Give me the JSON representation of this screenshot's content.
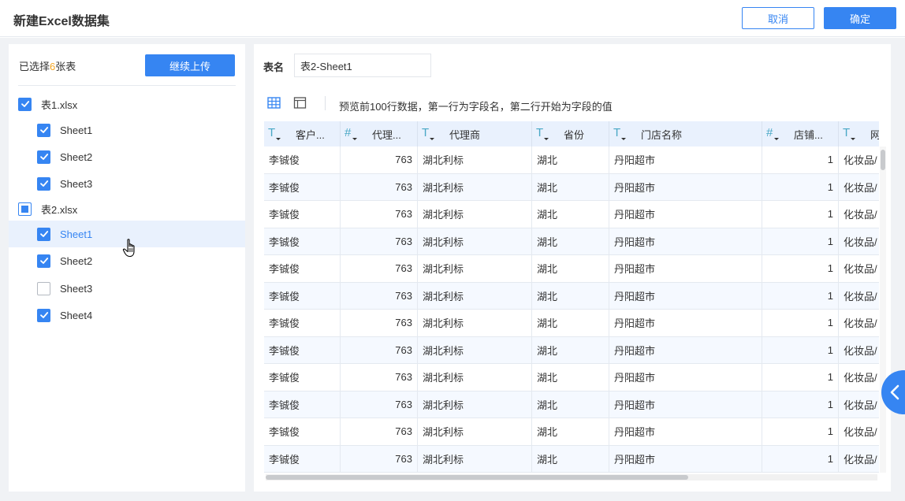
{
  "app": {
    "title": "新建Excel数据集"
  },
  "actions": {
    "cancel_label": "取消",
    "confirm_label": "确定"
  },
  "sidebar": {
    "selected_prefix": "已选择",
    "selected_count": "6",
    "selected_suffix": "张表",
    "continue_upload_label": "继续上传",
    "items": [
      {
        "label": "表1.xlsx",
        "state": "checked",
        "level": 0
      },
      {
        "label": "Sheet1",
        "state": "checked",
        "level": 1
      },
      {
        "label": "Sheet2",
        "state": "checked",
        "level": 1
      },
      {
        "label": "Sheet3",
        "state": "checked",
        "level": 1
      },
      {
        "label": "表2.xlsx",
        "state": "partial",
        "level": 0
      },
      {
        "label": "Sheet1",
        "state": "checked",
        "level": 1,
        "active": true
      },
      {
        "label": "Sheet2",
        "state": "checked",
        "level": 1
      },
      {
        "label": "Sheet3",
        "state": "unchecked",
        "level": 1
      },
      {
        "label": "Sheet4",
        "state": "checked",
        "level": 1
      }
    ]
  },
  "main": {
    "table_name_label": "表名",
    "table_name_value": "表2-Sheet1",
    "preview_hint": "预览前100行数据，第一行为字段名，第二行开始为字段的值",
    "columns": [
      {
        "name": "客户...",
        "type": "text"
      },
      {
        "name": "代理...",
        "type": "number"
      },
      {
        "name": "代理商",
        "type": "text"
      },
      {
        "name": "省份",
        "type": "text"
      },
      {
        "name": "门店名称",
        "type": "text"
      },
      {
        "name": "店铺...",
        "type": "number"
      },
      {
        "name": "网",
        "type": "text"
      }
    ],
    "rows": [
      [
        "李铖俊",
        "763",
        "湖北利标",
        "湖北",
        "丹阳超市",
        "1",
        "化妆品/"
      ],
      [
        "李铖俊",
        "763",
        "湖北利标",
        "湖北",
        "丹阳超市",
        "1",
        "化妆品/"
      ],
      [
        "李铖俊",
        "763",
        "湖北利标",
        "湖北",
        "丹阳超市",
        "1",
        "化妆品/"
      ],
      [
        "李铖俊",
        "763",
        "湖北利标",
        "湖北",
        "丹阳超市",
        "1",
        "化妆品/"
      ],
      [
        "李铖俊",
        "763",
        "湖北利标",
        "湖北",
        "丹阳超市",
        "1",
        "化妆品/"
      ],
      [
        "李铖俊",
        "763",
        "湖北利标",
        "湖北",
        "丹阳超市",
        "1",
        "化妆品/"
      ],
      [
        "李铖俊",
        "763",
        "湖北利标",
        "湖北",
        "丹阳超市",
        "1",
        "化妆品/"
      ],
      [
        "李铖俊",
        "763",
        "湖北利标",
        "湖北",
        "丹阳超市",
        "1",
        "化妆品/"
      ],
      [
        "李铖俊",
        "763",
        "湖北利标",
        "湖北",
        "丹阳超市",
        "1",
        "化妆品/"
      ],
      [
        "李铖俊",
        "763",
        "湖北利标",
        "湖北",
        "丹阳超市",
        "1",
        "化妆品/"
      ],
      [
        "李铖俊",
        "763",
        "湖北利标",
        "湖北",
        "丹阳超市",
        "1",
        "化妆品/"
      ],
      [
        "李铖俊",
        "763",
        "湖北利标",
        "湖北",
        "丹阳超市",
        "1",
        "化妆品/"
      ]
    ]
  },
  "icons": {
    "grid_view": "table-grid-icon",
    "card_view": "layout-panel-icon",
    "collapse": "chevron-left-icon",
    "cursor": "hand-pointer-icon",
    "text_type": "text-type-icon",
    "number_type": "number-type-icon"
  },
  "colors": {
    "accent": "#3685f2",
    "highlight_count": "#f5a623",
    "header_bg": "#e9f1fd"
  }
}
